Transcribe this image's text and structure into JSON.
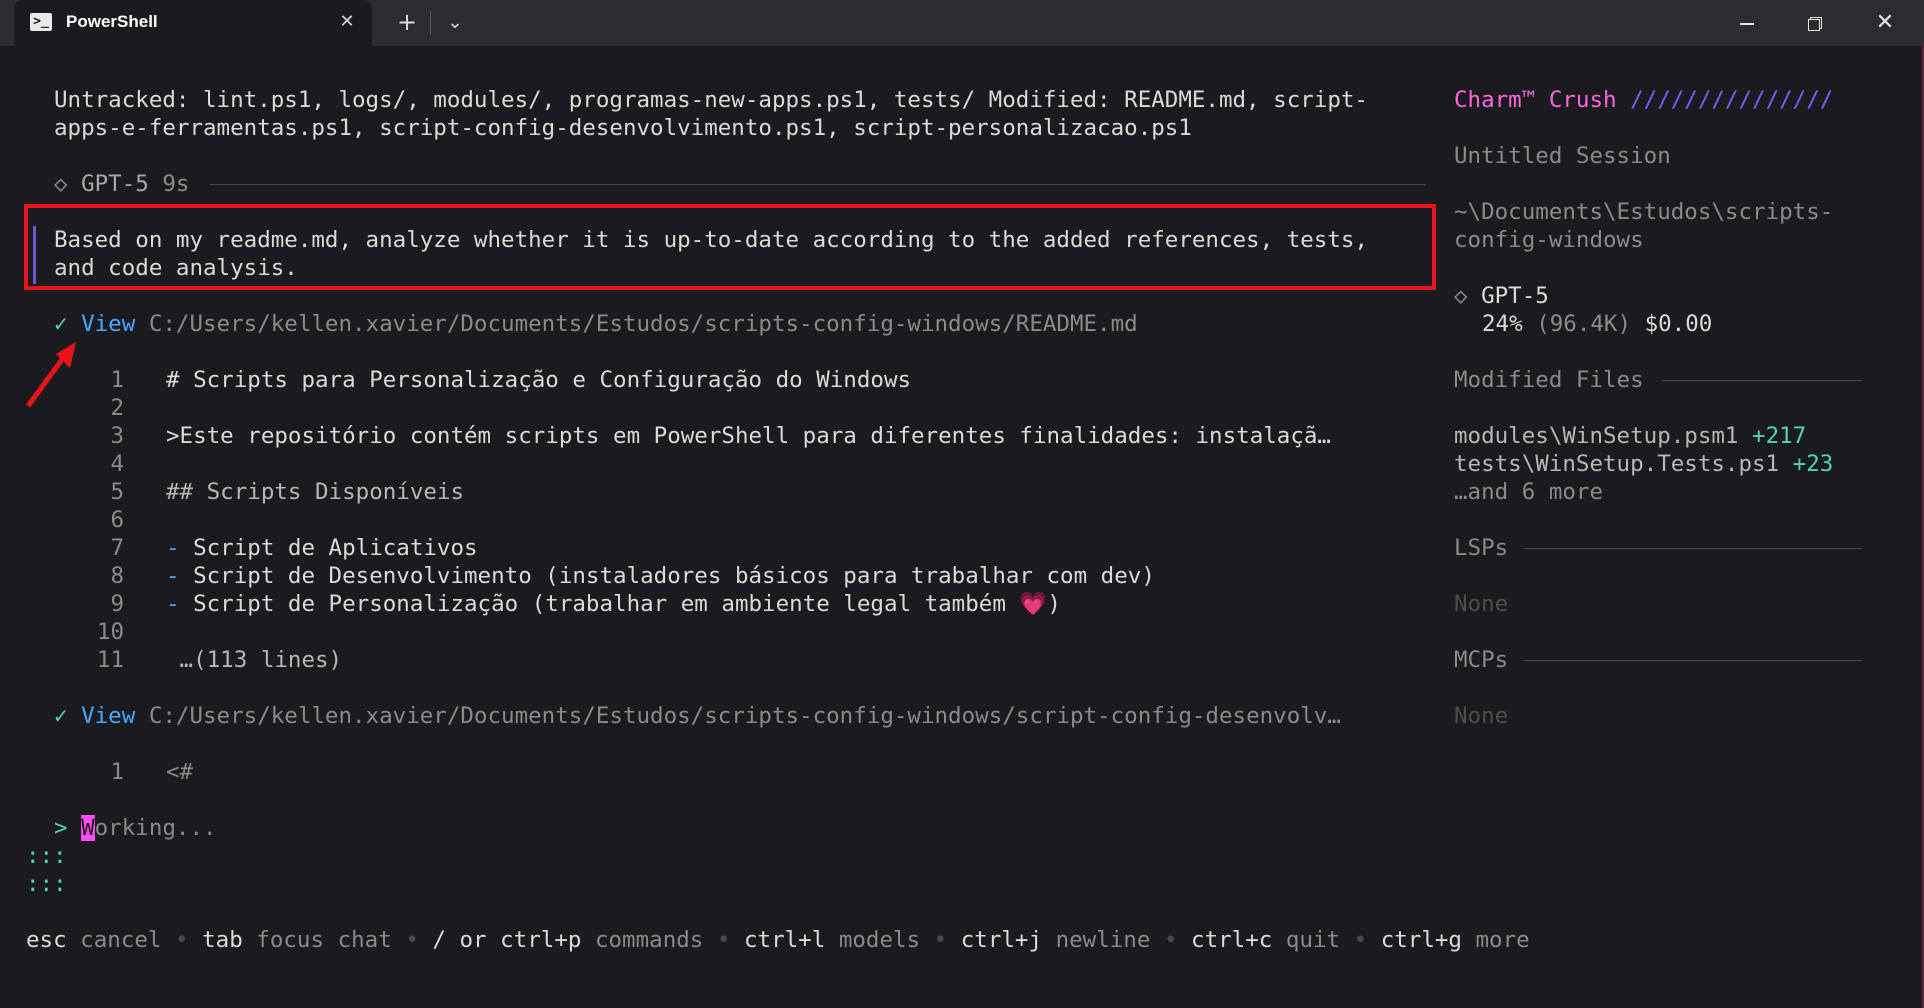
{
  "window": {
    "tab_title": "PowerShell",
    "tab_icon": "powershell-icon",
    "new_tab_icon": "plus-icon",
    "dropdown_icon": "chevron-down-icon",
    "controls": [
      "minimize-icon",
      "restore-icon",
      "close-icon"
    ]
  },
  "chat": {
    "git_status_line1": "Untracked: lint.ps1, logs/, modules/, programas-new-apps.ps1, tests/ Modified: README.md, script-",
    "git_status_line2": "apps-e-ferramentas.ps1, script-config-desenvolvimento.ps1, script-personalizacao.ps1",
    "model_marker": "◇",
    "model_name": "GPT-5",
    "model_time": "9s",
    "prompt_line1": "Based on my readme.md, analyze whether it is up-to-date according to the added references, tests,",
    "prompt_line2": "and code analysis.",
    "tool_calls": [
      {
        "check": "✓",
        "action": "View",
        "path": "C:/Users/kellen.xavier/Documents/Estudos/scripts-config-windows/README.md",
        "lines": [
          {
            "num": "1",
            "text": "# Scripts para Personalização e Configuração do Windows"
          },
          {
            "num": "2",
            "text": ""
          },
          {
            "num": "3",
            "text": ">Este repositório contém scripts em PowerShell para diferentes finalidades: instalaçã…"
          },
          {
            "num": "4",
            "text": ""
          },
          {
            "num": "5",
            "text": "## Scripts Disponíveis"
          },
          {
            "num": "6",
            "text": ""
          },
          {
            "num": "7",
            "bullet": "-",
            "text": " Script de Aplicativos"
          },
          {
            "num": "8",
            "bullet": "-",
            "text": " Script de Desenvolvimento (instaladores básicos para trabalhar com dev)"
          },
          {
            "num": "9",
            "bullet": "-",
            "text": " Script de Personalização (trabalhar em ambiente legal também 💗)"
          },
          {
            "num": "10",
            "text": ""
          },
          {
            "num": "11",
            "text": " …(113 lines)"
          }
        ]
      },
      {
        "check": "✓",
        "action": "View",
        "path": "C:/Users/kellen.xavier/Documents/Estudos/scripts-config-windows/script-config-desenvolv…",
        "lines": [
          {
            "num": "1",
            "text": "<#"
          }
        ]
      }
    ],
    "status_prompt": ">",
    "status_cursor": "W",
    "status_text": "orking...",
    "spinner_line1": ":::",
    "spinner_line2": ":::"
  },
  "sidebar": {
    "brand": "Charm™ Crush",
    "brand_slashes": "///////////////",
    "session_title": "Untitled Session",
    "path_line1": "~\\Documents\\Estudos\\scripts-",
    "path_line2": "config-windows",
    "model_marker": "◇",
    "model_name": "GPT-5",
    "context_pct": "24%",
    "context_tokens": "(96.4K)",
    "cost": "$0.00",
    "modified_header": "Modified Files",
    "modified_files": [
      {
        "name": "modules\\WinSetup.psm1",
        "delta": "+217"
      },
      {
        "name": "tests\\WinSetup.Tests.ps1",
        "delta": "+23"
      }
    ],
    "modified_more": "…and 6 more",
    "lsps_header": "LSPs",
    "lsps_value": "None",
    "mcps_header": "MCPs",
    "mcps_value": "None"
  },
  "footer": [
    {
      "key": "esc",
      "desc": "cancel"
    },
    {
      "key": "tab",
      "desc": "focus chat"
    },
    {
      "key": "/ or ctrl+p",
      "desc": "commands"
    },
    {
      "key": "ctrl+l",
      "desc": "models"
    },
    {
      "key": "ctrl+j",
      "desc": "newline"
    },
    {
      "key": "ctrl+c",
      "desc": "quit"
    },
    {
      "key": "ctrl+g",
      "desc": "more"
    }
  ],
  "footer_separator": "•",
  "colors": {
    "background": "#1b1a1e",
    "accent_green": "#4fd6b0",
    "accent_blue": "#47a8ff",
    "brand_pink": "#ff66e0",
    "brand_purple": "#7d5bff",
    "highlight_red": "#e8141c"
  }
}
